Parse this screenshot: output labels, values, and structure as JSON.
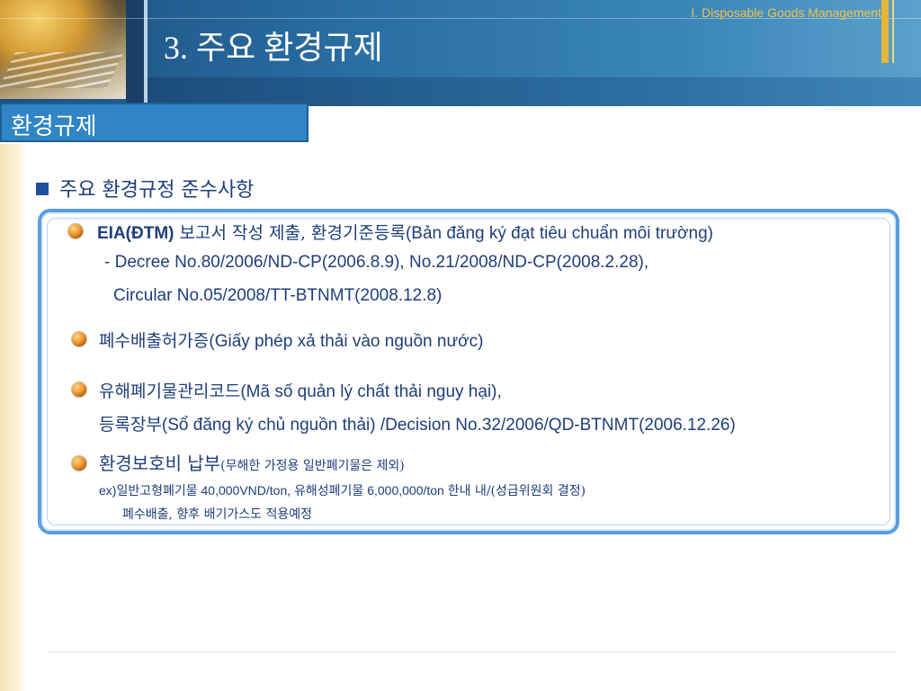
{
  "header": {
    "subtitle": "I. Disposable Goods Management",
    "title": "3. 주요 환경규제"
  },
  "section_tab": "환경규제",
  "heading": "주요 환경규정 준수사항",
  "items": {
    "item1": {
      "label_bold": "EIA(ĐTM)",
      "label_kr": " 보고서 작성 제출, 환경기준등록",
      "label_vi": "(Bản đăng ký đạt tiêu chuẩn môi trường)",
      "line2": "- Decree No.80/2006/ND-CP(2006.8.9), No.21/2008/ND-CP(2008.2.28),",
      "line3": "Circular No.05/2008/TT-BTNMT(2008.12.8)"
    },
    "item2": {
      "label_kr": "폐수배출허가증",
      "label_vi": "(Giấy phép xả thải vào nguồn nước)"
    },
    "item3": {
      "label_kr": "유해폐기물관리코드",
      "label_vi": "(Mã số quản lý chất thải nguy hại),",
      "line2_kr": "등록장부",
      "line2_rest": "(Sổ đăng ký chủ nguồn thải) /Decision No.32/2006/QD-BTNMT(2006.12.26)"
    },
    "item4": {
      "label_kr": "환경보호비 납부",
      "label_note": "(무해한 가정용 일반폐기물은 제외)",
      "ex_prefix": "ex)",
      "ex_kr1": "일반고형폐기물",
      "ex_num1": " 40,000VND/ton, ",
      "ex_kr2": "유해성폐기물",
      "ex_num2": " 6,000,000/ton ",
      "ex_kr3": "한내 내/(성급위원회 결정)",
      "ex_line2": "폐수배출, 향후 배기가스도 적용예정"
    }
  }
}
